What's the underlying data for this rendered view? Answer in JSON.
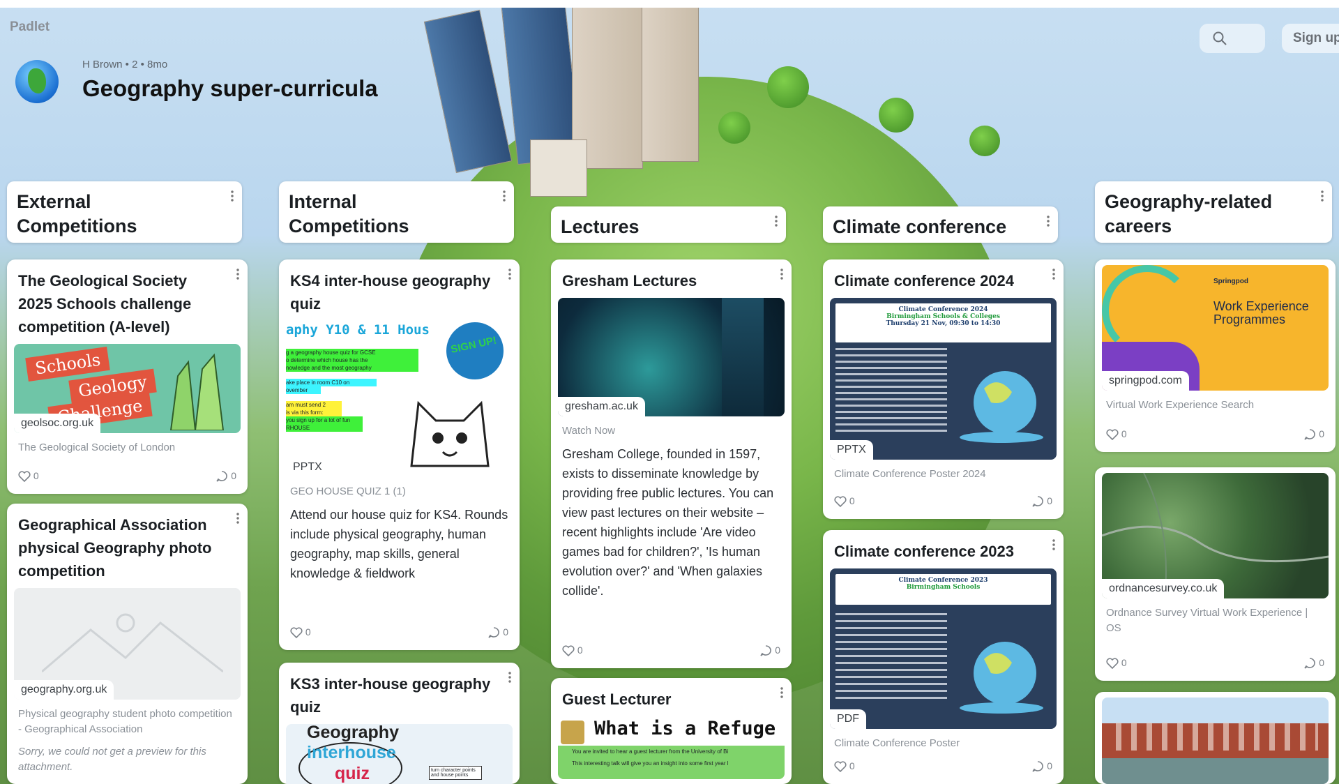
{
  "app": {
    "brand": "Padlet"
  },
  "header": {
    "author": "H Brown • 2 • 8mo",
    "title": "Geography super-curricula",
    "signup": "Sign up"
  },
  "columns": [
    {
      "title": "External\nCompetitions"
    },
    {
      "title": "Internal\nCompetitions"
    },
    {
      "title": "Lectures"
    },
    {
      "title": "Climate conference"
    },
    {
      "title": "Geography-related\ncareers"
    }
  ],
  "cards": {
    "geol": {
      "title": "The Geological Society 2025 Schools challenge competition (A-level)",
      "thumb_text1": "Schools",
      "thumb_text2": "Geology",
      "thumb_text3": "Challenge",
      "tag": "geolsoc.org.uk",
      "sub": "The Geological Society of London",
      "likes": "0",
      "comments": "0"
    },
    "ga": {
      "title": "Geographical Association physical Geography photo competition",
      "tag": "geography.org.uk",
      "sub": "Physical geography student photo competition - Geographical Association",
      "note": "Sorry, we could not get a preview for this attachment."
    },
    "ks4": {
      "title": "KS4 inter-house geography quiz",
      "thumb_head": "aphy Y10 & 11 Hous",
      "sign": "SIGN UP!",
      "line1": "g a geography house quiz for GCSE",
      "line2": "o determine which house has the",
      "line3": "nowledge and the most geography",
      "line4": "ake place in room C10 on",
      "line5": "ovember",
      "line6": "am must send 2",
      "line7": "is via this form:",
      "line8": "you sign up for a lot of fun",
      "line9": "RHOUSE",
      "tag": "PPTX",
      "sub": "GEO HOUSE QUIZ 1 (1)",
      "body": "Attend our house quiz for KS4. Rounds include physical geography, human geography, map skills, general knowledge & fieldwork",
      "likes": "0",
      "comments": "0"
    },
    "ks3": {
      "title": "KS3 inter-house geography quiz",
      "thumb1": "Geography",
      "thumb2": "interhouse",
      "thumb3": "quiz",
      "side": "turn character points and house points"
    },
    "gresham": {
      "title": "Gresham Lectures",
      "tag": "gresham.ac.uk",
      "sub": "Watch Now",
      "body": "Gresham College, founded in 1597, exists to disseminate knowledge by providing free public lectures. You can view past lectures on their website – recent highlights include 'Are video games bad for children?', 'Is human evolution over?' and 'When galaxies collide'.",
      "likes": "0",
      "comments": "0"
    },
    "guest": {
      "title": "Guest Lecturer",
      "thumb": "What is a Refuge",
      "line1": "You are invited to hear a guest lecturer from the University of Bi",
      "line2": "This interesting talk will give you an insight into some first year l"
    },
    "cc2024": {
      "title": "Climate conference 2024",
      "poster_title": "Climate Conference 2024",
      "poster_sub": "Birmingham Schools & Colleges",
      "poster_date": "Thursday 21 Nov, 09:30 to 14:30",
      "tag": "PPTX",
      "sub": "Climate Conference Poster 2024",
      "likes": "0",
      "comments": "0"
    },
    "cc2023": {
      "title": "Climate conference 2023",
      "poster_title": "Climate Conference 2023",
      "poster_sub": "Birmingham Schools",
      "tag": "PDF",
      "sub": "Climate Conference Poster",
      "likes": "0",
      "comments": "0"
    },
    "springpod": {
      "title": "Work Experience Programmes",
      "brandmark": "Springpod",
      "tag": "springpod.com",
      "sub": "Virtual Work Experience Search",
      "likes": "0",
      "comments": "0"
    },
    "os": {
      "tag": "ordnancesurvey.co.uk",
      "sub": "Ordnance Survey Virtual Work Experience | OS",
      "likes": "0",
      "comments": "0"
    },
    "building": {}
  }
}
